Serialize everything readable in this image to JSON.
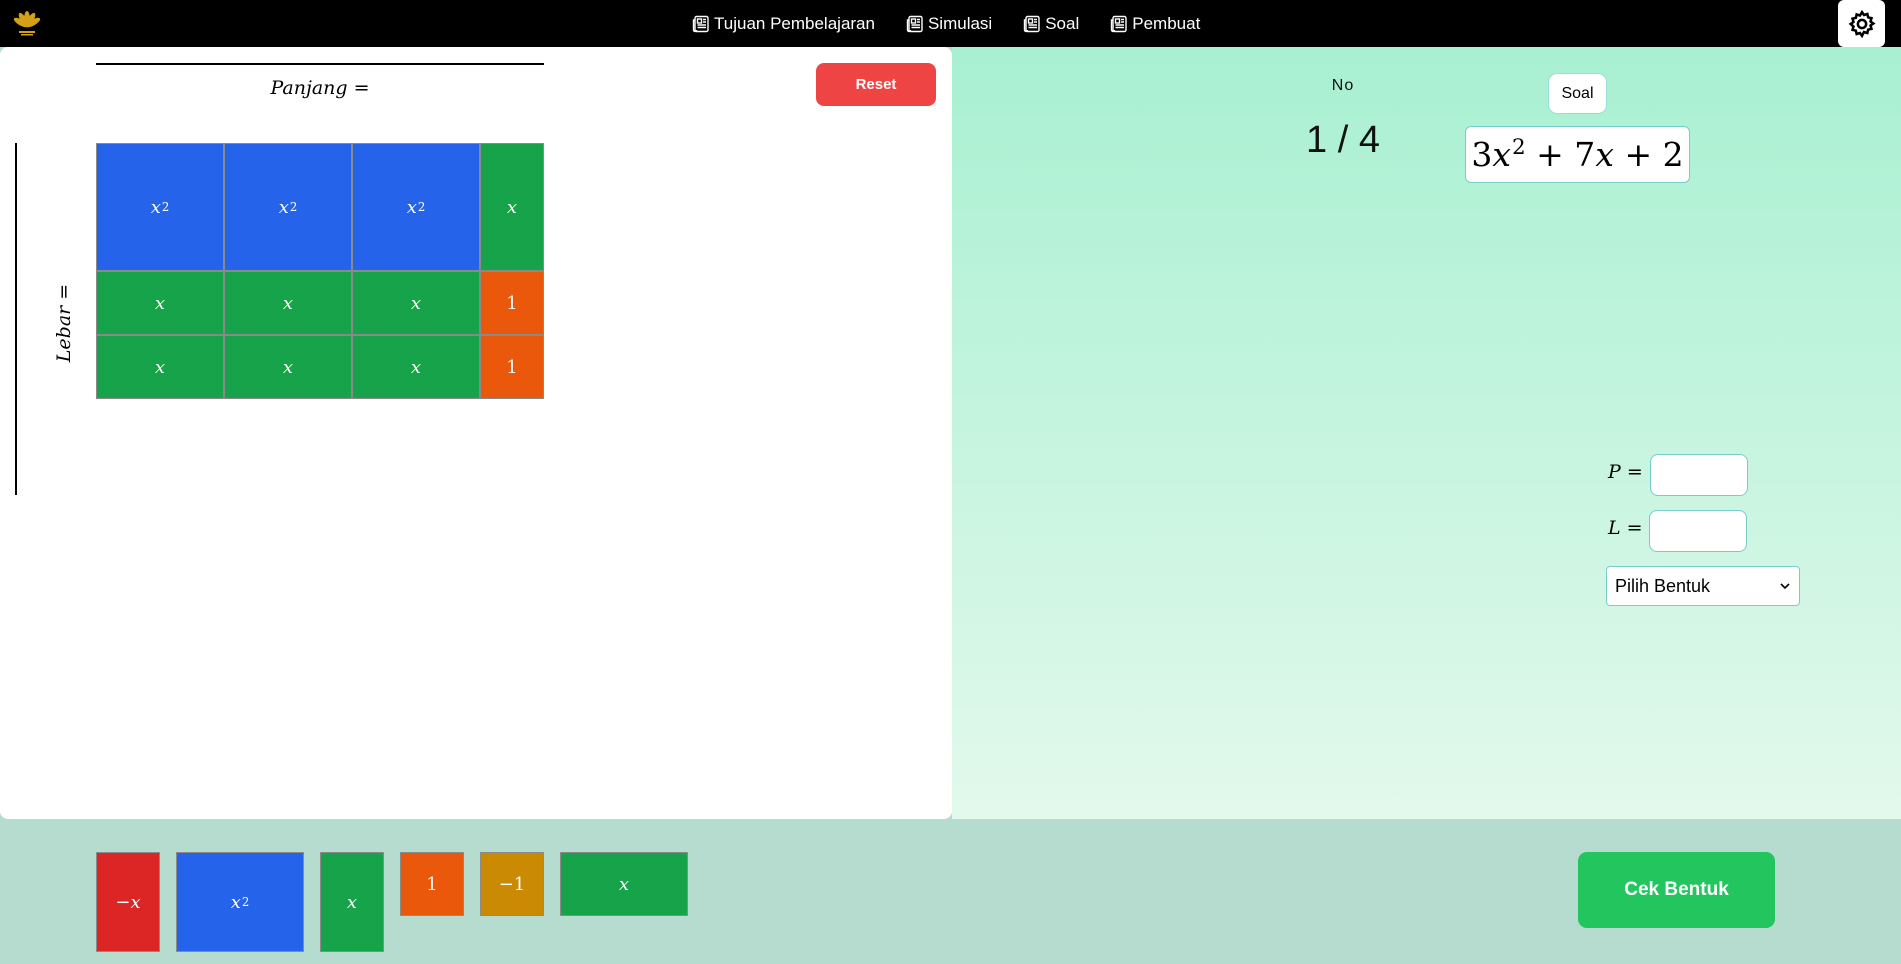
{
  "nav": {
    "items": [
      {
        "label": "Tujuan Pembelajaran"
      },
      {
        "label": "Simulasi"
      },
      {
        "label": "Soal"
      },
      {
        "label": "Pembuat"
      }
    ]
  },
  "workspace": {
    "panjang_label": "Panjang =",
    "lebar_label": "Lebar =",
    "reset_label": "Reset",
    "grid": {
      "x2": "x",
      "x2_exp": "2",
      "x": "x",
      "one": "1"
    }
  },
  "panel": {
    "no_label": "No",
    "counter": "1 / 4",
    "soal_label": "Soal",
    "expression": {
      "t1_coef": "3",
      "t1_var": "x",
      "t1_exp": "2",
      "t2": "+ 7",
      "t2_var": "x",
      "t3": "+ 2"
    },
    "p_label": "P =",
    "l_label": "L =",
    "p_value": "",
    "l_value": "",
    "select_value": "Pilih Bentuk"
  },
  "palette": {
    "neg_x": "−x",
    "x2_base": "x",
    "x2_exp": "2",
    "x": "x",
    "one": "1",
    "neg_one": "−1",
    "x_wide": "x"
  },
  "cek_label": "Cek Bentuk",
  "colors": {
    "blue_tile": "#2563eb",
    "green_tile": "#16a34a",
    "orange_tile": "#ea580c",
    "yellow_tile": "#ca8a04",
    "red_tile": "#dc2626",
    "reset": "#ef4444",
    "cek": "#22c55e"
  }
}
